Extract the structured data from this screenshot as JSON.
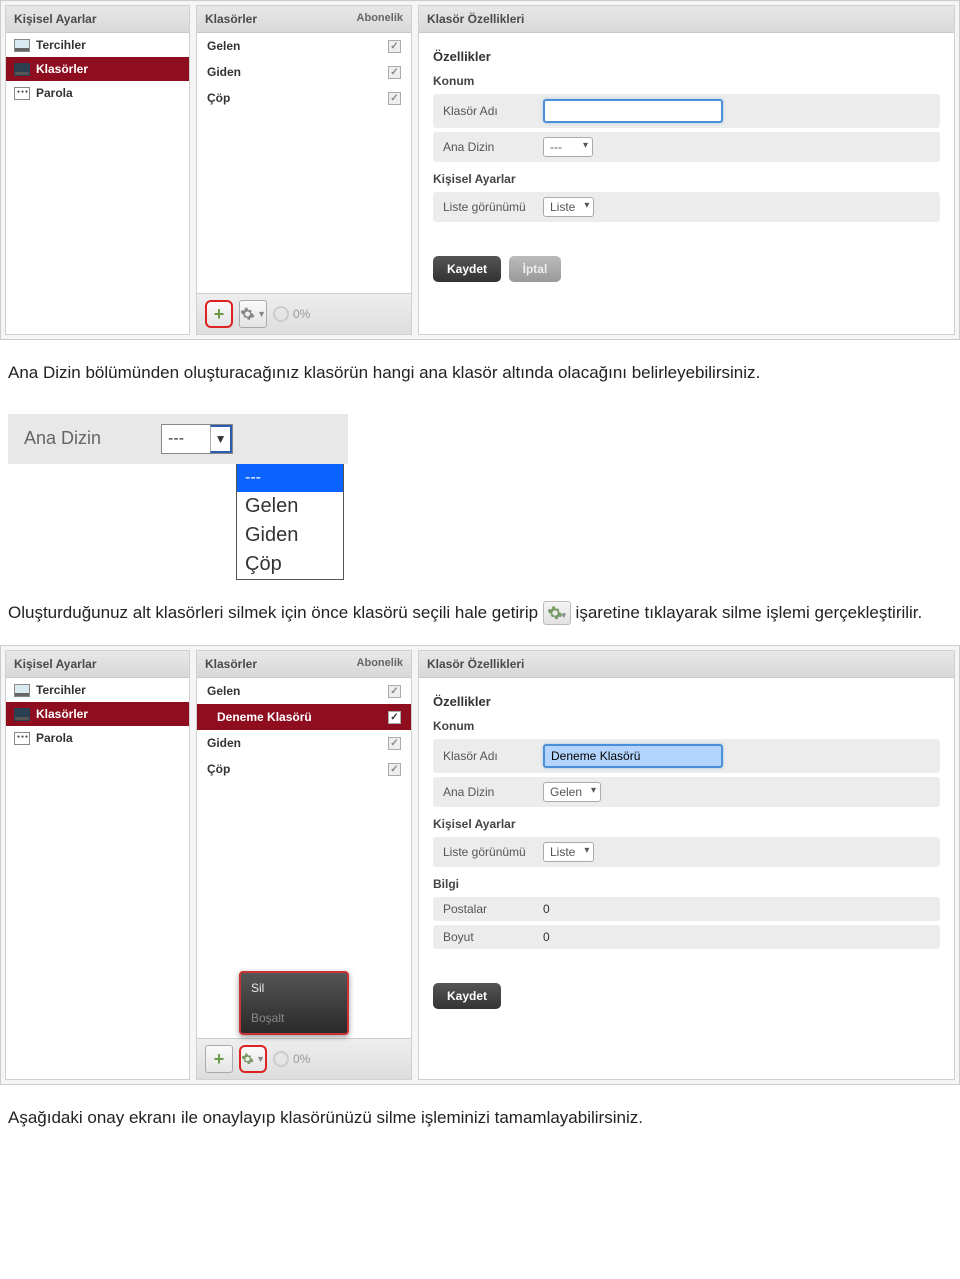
{
  "shot1": {
    "p1_title": "Kişisel Ayarlar",
    "nav": [
      {
        "label": "Tercihler"
      },
      {
        "label": "Klasörler"
      },
      {
        "label": "Parola"
      }
    ],
    "p2_title": "Klasörler",
    "p2_sub": "Abonelik",
    "folders": [
      {
        "label": "Gelen"
      },
      {
        "label": "Giden"
      },
      {
        "label": "Çöp"
      }
    ],
    "quota": "0%",
    "p3_title": "Klasör Özellikleri",
    "props": {
      "h_ozellikler": "Özellikler",
      "h_konum": "Konum",
      "klasor_adi_lbl": "Klasör Adı",
      "klasor_adi_val": "",
      "ana_dizin_lbl": "Ana Dizin",
      "ana_dizin_val": "---",
      "h_kisisel": "Kişisel Ayarlar",
      "liste_lbl": "Liste görünümü",
      "liste_val": "Liste",
      "btn_save": "Kaydet",
      "btn_cancel": "İptal"
    }
  },
  "para1": "Ana Dizin bölümünden oluşturacağınız klasörün hangi ana klasör altında olacağını belirleyebilirsiniz.",
  "anadizin": {
    "lbl": "Ana Dizin",
    "sel": "---",
    "opts": [
      "---",
      "Gelen",
      "Giden",
      "Çöp"
    ]
  },
  "para2_pre": "Oluşturduğunuz alt klasörleri silmek için önce klasörü seçili hale getirip",
  "para2_post": "işaretine tıklayarak silme işlemi gerçekleştirilir.",
  "shot2": {
    "p1_title": "Kişisel Ayarlar",
    "nav": [
      {
        "label": "Tercihler"
      },
      {
        "label": "Klasörler"
      },
      {
        "label": "Parola"
      }
    ],
    "p2_title": "Klasörler",
    "p2_sub": "Abonelik",
    "folders": [
      {
        "label": "Gelen",
        "child": false,
        "sel": false,
        "chk": false
      },
      {
        "label": "Deneme Klasörü",
        "child": true,
        "sel": true,
        "chk": true
      },
      {
        "label": "Giden",
        "child": false,
        "sel": false,
        "chk": false
      },
      {
        "label": "Çöp",
        "child": false,
        "sel": false,
        "chk": false
      }
    ],
    "ctx": {
      "sil": "Sil",
      "bosalt": "Boşalt"
    },
    "quota": "0%",
    "p3_title": "Klasör Özellikleri",
    "props": {
      "h_ozellikler": "Özellikler",
      "h_konum": "Konum",
      "klasor_adi_lbl": "Klasör Adı",
      "klasor_adi_val": "Deneme Klasörü",
      "ana_dizin_lbl": "Ana Dizin",
      "ana_dizin_val": "Gelen",
      "h_kisisel": "Kişisel Ayarlar",
      "liste_lbl": "Liste görünümü",
      "liste_val": "Liste",
      "h_bilgi": "Bilgi",
      "postalar_lbl": "Postalar",
      "postalar_val": "0",
      "boyut_lbl": "Boyut",
      "boyut_val": "0",
      "btn_save": "Kaydet"
    }
  },
  "para3": "Aşağıdaki onay ekranı ile onaylayıp klasörünüzü silme işleminizi tamamlayabilirsiniz."
}
